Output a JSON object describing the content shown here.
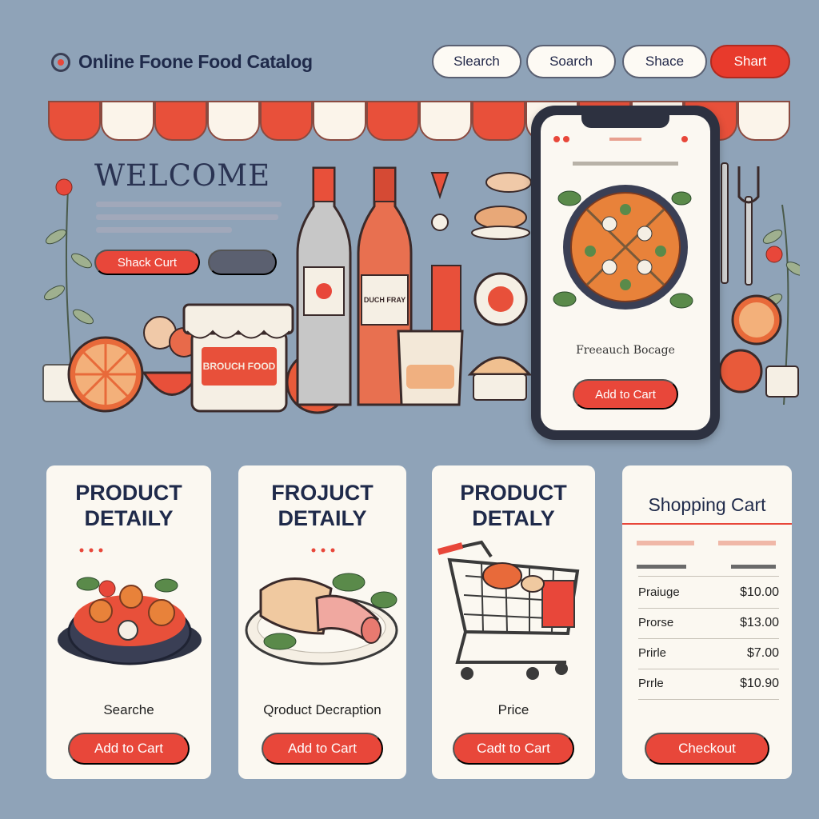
{
  "header": {
    "title": "Online Foone Food Catalog",
    "nav": [
      "Slearch",
      "Soarch",
      "Shace",
      "Shart"
    ]
  },
  "hero": {
    "welcome": "WELCOME",
    "primary_button": "Shack Curt",
    "jar_label": "BROUCH FOOD",
    "bottle_label": "DUCH FRAY"
  },
  "phone": {
    "label": "Freeauch Bocage",
    "button": "Add to Cart"
  },
  "cards": [
    {
      "title": "PRODUCT DETAILY",
      "caption": "Searche",
      "button": "Add to Cart"
    },
    {
      "title": "FROJUCT DETAILY",
      "caption": "Qroduct Decraption",
      "button": "Add to Cart"
    },
    {
      "title": "PRODUCT DETALY",
      "caption": "Price",
      "button": "Cadt to Cart"
    }
  ],
  "cart": {
    "title": "Shopping Cart",
    "items": [
      {
        "name": "Praiuge",
        "price": "$10.00"
      },
      {
        "name": "Prorse",
        "price": "$13.00"
      },
      {
        "name": "Prirle",
        "price": "$7.00"
      },
      {
        "name": "Prrle",
        "price": "$10.90"
      }
    ],
    "checkout": "Checkout"
  },
  "colors": {
    "accent": "#e8473a",
    "background": "#8fa3b8",
    "card": "#fbf8f1",
    "text": "#1f2a4a"
  }
}
